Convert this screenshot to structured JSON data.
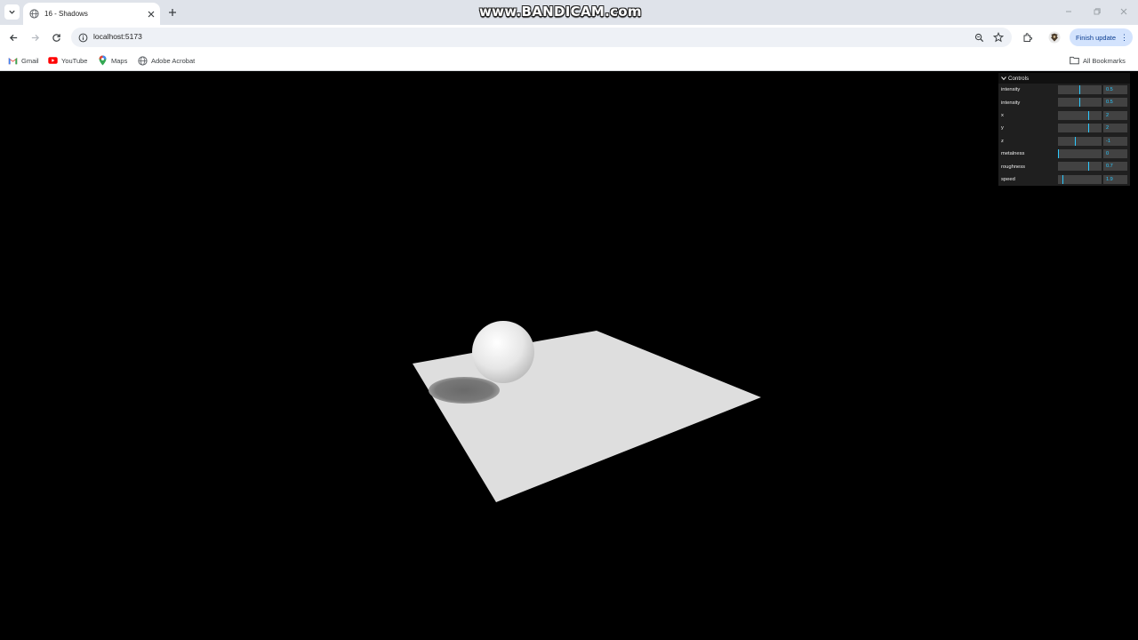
{
  "browser": {
    "tab_title": "16 - Shadows",
    "watermark": "www.BANDICAM.com",
    "url": "localhost:5173",
    "update_button": "Finish update",
    "bookmarks": [
      {
        "label": "Gmail",
        "icon": "gmail-icon"
      },
      {
        "label": "YouTube",
        "icon": "youtube-icon"
      },
      {
        "label": "Maps",
        "icon": "maps-icon"
      },
      {
        "label": "Adobe Acrobat",
        "icon": "acrobat-icon"
      }
    ],
    "all_bookmarks": "All Bookmarks"
  },
  "gui": {
    "title": "Controls",
    "controls": [
      {
        "label": "intensity",
        "value": "0.5",
        "fraction": 0.5
      },
      {
        "label": "intensity",
        "value": "0.5",
        "fraction": 0.5
      },
      {
        "label": "x",
        "value": "2",
        "fraction": 0.7
      },
      {
        "label": "y",
        "value": "2",
        "fraction": 0.7
      },
      {
        "label": "z",
        "value": "-1",
        "fraction": 0.4
      },
      {
        "label": "metalness",
        "value": "0",
        "fraction": 0.0
      },
      {
        "label": "roughness",
        "value": "0.7",
        "fraction": 0.7
      },
      {
        "label": "speed",
        "value": "1.9",
        "fraction": 0.1
      }
    ]
  },
  "colors": {
    "accent": "#2cc9ff",
    "scene_background": "#000000",
    "plane": "#dedede",
    "sphere": "#f2f2f2",
    "shadow": "#6e6e6e"
  }
}
